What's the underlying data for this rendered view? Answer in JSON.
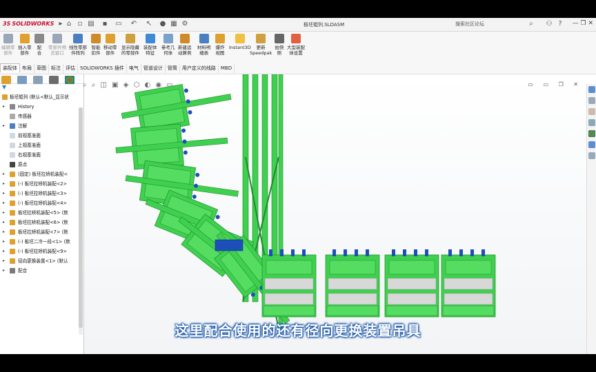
{
  "titlebar": {
    "logo_ds": "3S",
    "logo_text": "SOLIDWORKS",
    "document_title": "板坯辊列.SLDASM",
    "search_placeholder": "搜索社区论坛",
    "window_controls": "—  ❐  ✕"
  },
  "commands": [
    {
      "label": "编辑零\n部件",
      "disabled": true,
      "color": "#9aa7b6"
    },
    {
      "label": "插入零\n部件",
      "disabled": false,
      "color": "#e0a030"
    },
    {
      "label": "配\n合",
      "disabled": false,
      "color": "#8a8a8a"
    },
    {
      "label": "零部件预\n览窗口",
      "disabled": true,
      "color": "#9aa7b6"
    },
    {
      "label": "线性零部\n件阵列",
      "disabled": false,
      "color": "#4a7fc1"
    },
    {
      "label": "智能\n扣件",
      "disabled": false,
      "color": "#d08a2a"
    },
    {
      "label": "移动零\n部件",
      "disabled": false,
      "color": "#e0a030"
    },
    {
      "label": "显示隐藏\n的零部件",
      "disabled": false,
      "color": "#d0a040"
    },
    {
      "label": "装配体\n特征",
      "disabled": false,
      "color": "#3e8ad6"
    },
    {
      "label": "参考几\n何体",
      "disabled": false,
      "color": "#7aa3cc"
    },
    {
      "label": "新建运\n动算例",
      "disabled": false,
      "color": "#d08a2a"
    },
    {
      "label": "材料明\n细表",
      "disabled": false,
      "color": "#4a7fc1"
    },
    {
      "label": "爆炸\n视图",
      "disabled": false,
      "color": "#e0a030"
    },
    {
      "label": "Instant3D",
      "disabled": false,
      "color": "#f0c040"
    },
    {
      "label": "更新\nSpeedpak",
      "disabled": false,
      "color": "#d0a040"
    },
    {
      "label": "拍快\n照",
      "disabled": false,
      "color": "#666666"
    },
    {
      "label": "大型装配\n体设置",
      "disabled": false,
      "color": "#e06040"
    }
  ],
  "tabs": [
    "装配体",
    "布局",
    "草图",
    "标注",
    "评估",
    "SOLIDWORKS 插件",
    "电气",
    "管道设计",
    "管筒",
    "用户定义的线路",
    "MBD"
  ],
  "active_tab": "装配体",
  "tree": {
    "filter_icon": "filter-icon",
    "root": "板坯辊列 (默认<默认_显示状",
    "nodes": [
      {
        "label": "History",
        "icon": "history-icon",
        "color": "#888888",
        "twisty": "▸"
      },
      {
        "label": "传感器",
        "icon": "sensor-icon",
        "color": "#aaaaaa",
        "twisty": ""
      },
      {
        "label": "注解",
        "icon": "annotation-icon",
        "color": "#4a7fc1",
        "twisty": "▸"
      },
      {
        "label": "前视基准面",
        "icon": "plane-icon",
        "color": "#cfd8e3",
        "twisty": ""
      },
      {
        "label": "上视基准面",
        "icon": "plane-icon",
        "color": "#cfd8e3",
        "twisty": ""
      },
      {
        "label": "右视基准面",
        "icon": "plane-icon",
        "color": "#cfd8e3",
        "twisty": ""
      },
      {
        "label": "原点",
        "icon": "origin-icon",
        "color": "#444444",
        "twisty": ""
      },
      {
        "label": "(固定) 板坯拉矫机装配<",
        "icon": "subassembly-icon",
        "color": "#e0a030",
        "twisty": "▸"
      },
      {
        "label": "(-) 板坯拉矫机装配<2>",
        "icon": "subassembly-icon",
        "color": "#e0a030",
        "twisty": "▸"
      },
      {
        "label": "(-) 板坯拉矫机装配<3>",
        "icon": "subassembly-icon",
        "color": "#e0a030",
        "twisty": "▸"
      },
      {
        "label": "(-) 板坯拉矫机装配<4>",
        "icon": "subassembly-icon",
        "color": "#e0a030",
        "twisty": "▸"
      },
      {
        "label": "板坯拉矫机装配<5> (默",
        "icon": "subassembly-icon",
        "color": "#e0a030",
        "twisty": "▸"
      },
      {
        "label": "板坯拉矫机装配<6> (默",
        "icon": "subassembly-icon",
        "color": "#e0a030",
        "twisty": "▸"
      },
      {
        "label": "板坯拉矫机装配<7> (默",
        "icon": "subassembly-icon",
        "color": "#e0a030",
        "twisty": "▸"
      },
      {
        "label": "(-) 板坯二冷一段<1> (默",
        "icon": "subassembly-icon",
        "color": "#e0a030",
        "twisty": "▸"
      },
      {
        "label": "(-) 板坯拉矫机装配<9>",
        "icon": "subassembly-icon",
        "color": "#e0a030",
        "twisty": "▸"
      },
      {
        "label": "径向更换装置<1> (默认",
        "icon": "subassembly-icon",
        "color": "#e0a030",
        "twisty": "▸"
      },
      {
        "label": "配合",
        "icon": "mates-icon",
        "color": "#7a7a7a",
        "twisty": "▸"
      }
    ]
  },
  "subtitle": "这里配合使用的还有径向更换装置吊具",
  "colors": {
    "model_green": "#3fd04f",
    "model_dark": "#1f8a2c",
    "bolt_blue": "#1d4fb8",
    "roller_gray": "#d8d8d8"
  }
}
